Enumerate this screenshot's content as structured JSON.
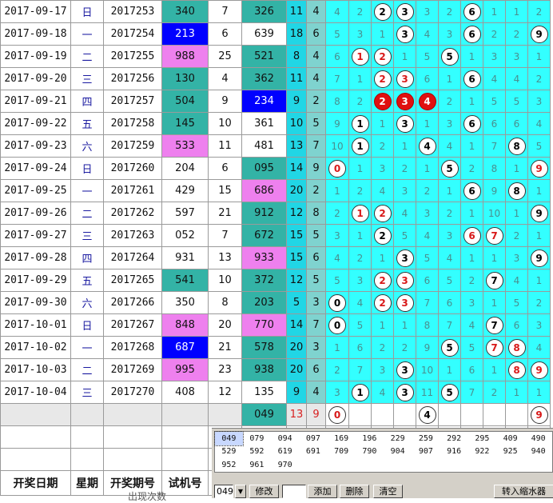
{
  "rows": [
    {
      "date": "2017-09-17",
      "wd": "日",
      "period": "2017253",
      "trial": "340",
      "trial_color": "teal",
      "c5": "7",
      "c6": "326",
      "c6_color": "teal",
      "c7": "11",
      "c8": "4",
      "cells": [
        "4",
        "2",
        "B:2",
        "B:3",
        "3",
        "2",
        "B:6",
        "1",
        "1",
        "2"
      ]
    },
    {
      "date": "2017-09-18",
      "wd": "一",
      "period": "2017254",
      "trial": "213",
      "trial_color": "blue",
      "c5": "6",
      "c6": "639",
      "c6_color": "none",
      "c7": "18",
      "c8": "6",
      "cells": [
        "5",
        "3",
        "1",
        "B:3",
        "4",
        "3",
        "B:6",
        "2",
        "2",
        "B:9"
      ]
    },
    {
      "date": "2017-09-19",
      "wd": "二",
      "period": "2017255",
      "trial": "988",
      "trial_color": "pink",
      "c5": "25",
      "c6": "521",
      "c6_color": "teal",
      "c7": "8",
      "c8": "4",
      "cells": [
        "6",
        "R:1",
        "R:2",
        "1",
        "5",
        "B:5",
        "1",
        "3",
        "3",
        "1"
      ]
    },
    {
      "date": "2017-09-20",
      "wd": "三",
      "period": "2017256",
      "trial": "130",
      "trial_color": "teal",
      "c5": "4",
      "c6": "362",
      "c6_color": "teal",
      "c7": "11",
      "c8": "4",
      "cells": [
        "7",
        "1",
        "R:2",
        "R:3",
        "6",
        "1",
        "B:6",
        "4",
        "4",
        "2"
      ]
    },
    {
      "date": "2017-09-21",
      "wd": "四",
      "period": "2017257",
      "trial": "504",
      "trial_color": "teal",
      "c5": "9",
      "c6": "234",
      "c6_color": "blue",
      "c7": "9",
      "c8": "2",
      "cells": [
        "8",
        "2",
        "S:2",
        "S:3",
        "S:4",
        "2",
        "1",
        "5",
        "5",
        "3"
      ]
    },
    {
      "date": "2017-09-22",
      "wd": "五",
      "period": "2017258",
      "trial": "145",
      "trial_color": "teal",
      "c5": "10",
      "c6": "361",
      "c6_color": "none",
      "c7": "10",
      "c8": "5",
      "cells": [
        "9",
        "B:1",
        "1",
        "B:3",
        "1",
        "3",
        "B:6",
        "6",
        "6",
        "4"
      ]
    },
    {
      "date": "2017-09-23",
      "wd": "六",
      "period": "2017259",
      "trial": "533",
      "trial_color": "pink",
      "c5": "11",
      "c6": "481",
      "c6_color": "none",
      "c7": "13",
      "c8": "7",
      "cells": [
        "10",
        "B:1",
        "2",
        "1",
        "B:4",
        "4",
        "1",
        "7",
        "B:8",
        "5"
      ]
    },
    {
      "date": "2017-09-24",
      "wd": "日",
      "period": "2017260",
      "trial": "204",
      "trial_color": "none",
      "c5": "6",
      "c6": "095",
      "c6_color": "teal",
      "c7": "14",
      "c8": "9",
      "cells": [
        "R:0",
        "1",
        "3",
        "2",
        "1",
        "B:5",
        "2",
        "8",
        "1",
        "R:9"
      ]
    },
    {
      "date": "2017-09-25",
      "wd": "一",
      "period": "2017261",
      "trial": "429",
      "trial_color": "none",
      "c5": "15",
      "c6": "686",
      "c6_color": "pink",
      "c7": "20",
      "c8": "2",
      "cells": [
        "1",
        "2",
        "4",
        "3",
        "2",
        "1",
        "B:6",
        "9",
        "B:8",
        "1"
      ]
    },
    {
      "date": "2017-09-26",
      "wd": "二",
      "period": "2017262",
      "trial": "597",
      "trial_color": "none",
      "c5": "21",
      "c6": "912",
      "c6_color": "teal",
      "c7": "12",
      "c8": "8",
      "cells": [
        "2",
        "R:1",
        "R:2",
        "4",
        "3",
        "2",
        "1",
        "10",
        "1",
        "B:9"
      ]
    },
    {
      "date": "2017-09-27",
      "wd": "三",
      "period": "2017263",
      "trial": "052",
      "trial_color": "none",
      "c5": "7",
      "c6": "672",
      "c6_color": "teal",
      "c7": "15",
      "c8": "5",
      "cells": [
        "3",
        "1",
        "B:2",
        "5",
        "4",
        "3",
        "R:6",
        "R:7",
        "2",
        "1"
      ]
    },
    {
      "date": "2017-09-28",
      "wd": "四",
      "period": "2017264",
      "trial": "931",
      "trial_color": "none",
      "c5": "13",
      "c6": "933",
      "c6_color": "pink",
      "c7": "15",
      "c8": "6",
      "cells": [
        "4",
        "2",
        "1",
        "B:3",
        "5",
        "4",
        "1",
        "1",
        "3",
        "B:9"
      ]
    },
    {
      "date": "2017-09-29",
      "wd": "五",
      "period": "2017265",
      "trial": "541",
      "trial_color": "teal",
      "c5": "10",
      "c6": "372",
      "c6_color": "teal",
      "c7": "12",
      "c8": "5",
      "cells": [
        "5",
        "3",
        "R:2",
        "R:3",
        "6",
        "5",
        "2",
        "B:7",
        "4",
        "1"
      ]
    },
    {
      "date": "2017-09-30",
      "wd": "六",
      "period": "2017266",
      "trial": "350",
      "trial_color": "none",
      "c5": "8",
      "c6": "203",
      "c6_color": "teal",
      "c7": "5",
      "c8": "3",
      "cells": [
        "B:0",
        "4",
        "R:2",
        "R:3",
        "7",
        "6",
        "3",
        "1",
        "5",
        "2"
      ]
    },
    {
      "date": "2017-10-01",
      "wd": "日",
      "period": "2017267",
      "trial": "848",
      "trial_color": "pink",
      "c5": "20",
      "c6": "770",
      "c6_color": "pink",
      "c7": "14",
      "c8": "7",
      "cells": [
        "B:0",
        "5",
        "1",
        "1",
        "8",
        "7",
        "4",
        "B:7",
        "6",
        "3"
      ]
    },
    {
      "date": "2017-10-02",
      "wd": "一",
      "period": "2017268",
      "trial": "687",
      "trial_color": "blue",
      "c5": "21",
      "c6": "578",
      "c6_color": "teal",
      "c7": "20",
      "c8": "3",
      "cells": [
        "1",
        "6",
        "2",
        "2",
        "9",
        "B:5",
        "5",
        "R:7",
        "R:8",
        "4"
      ]
    },
    {
      "date": "2017-10-03",
      "wd": "二",
      "period": "2017269",
      "trial": "995",
      "trial_color": "pink",
      "c5": "23",
      "c6": "938",
      "c6_color": "teal",
      "c7": "20",
      "c8": "6",
      "cells": [
        "2",
        "7",
        "3",
        "B:3",
        "10",
        "1",
        "6",
        "1",
        "R:8",
        "R:9"
      ]
    },
    {
      "date": "2017-10-04",
      "wd": "三",
      "period": "2017270",
      "trial": "408",
      "trial_color": "none",
      "c5": "12",
      "c6": "135",
      "c6_color": "none",
      "c7": "9",
      "c8": "4",
      "cells": [
        "3",
        "B:1",
        "4",
        "B:3",
        "11",
        "B:5",
        "7",
        "2",
        "1",
        "1"
      ]
    }
  ],
  "summary": {
    "c6": "049",
    "c7": "13",
    "c8": "9",
    "cells": [
      "R:0",
      "",
      "",
      "",
      "B:4",
      "",
      "",
      "",
      "",
      "R:9"
    ]
  },
  "headers": {
    "date": "开奖日期",
    "weekday": "星期",
    "period": "开奖期号",
    "trial": "试机号"
  },
  "panel": {
    "numbers": [
      [
        "049",
        "079",
        "094",
        "097",
        "169",
        "196",
        "229",
        "259",
        "292",
        "295",
        "409",
        "490"
      ],
      [
        "529",
        "592",
        "619",
        "691",
        "709",
        "790",
        "904",
        "907",
        "916",
        "922",
        "925",
        "940"
      ],
      [
        "952",
        "961",
        "970",
        "",
        "",
        "",
        "",
        "",
        "",
        "",
        "",
        ""
      ]
    ],
    "combo_value": "049",
    "edit_label": "修改",
    "add_label": "添加",
    "delete_label": "删除",
    "clear_label": "清空",
    "shrink_label": "转入缩水器"
  },
  "footer_partial": "出现次数"
}
